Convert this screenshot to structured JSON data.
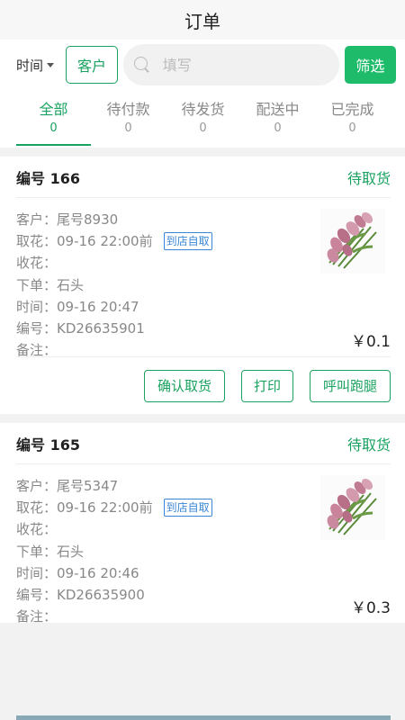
{
  "header": {
    "title": "订单"
  },
  "filter": {
    "time_label": "时间",
    "customer_label": "客户",
    "search_placeholder": "填写",
    "screen_label": "筛选"
  },
  "tabs": [
    {
      "label": "全部",
      "count": "0",
      "active": true
    },
    {
      "label": "待付款",
      "count": "0"
    },
    {
      "label": "待发货",
      "count": "0"
    },
    {
      "label": "配送中",
      "count": "0"
    },
    {
      "label": "已完成",
      "count": "0"
    }
  ],
  "orders": [
    {
      "number": "编号 166",
      "status": "待取货",
      "customer_key": "客户：",
      "customer": "尾号8930",
      "pickup_key": "取花：",
      "pickup": "09-16 22:00前",
      "pickup_tag": "到店自取",
      "receiver_key": "收花：",
      "receiver": "",
      "placer_key": "下单：",
      "placer": "石头",
      "time_key": "时间：",
      "time": "09-16 20:47",
      "code_key": "编号：",
      "code": "KD26635901",
      "note_key": "备注：",
      "note": "",
      "price": "￥0.1",
      "actions": [
        "确认取货",
        "打印",
        "呼叫跑腿"
      ]
    },
    {
      "number": "编号 165",
      "status": "待取货",
      "customer_key": "客户：",
      "customer": "尾号5347",
      "pickup_key": "取花：",
      "pickup": "09-16 22:00前",
      "pickup_tag": "到店自取",
      "receiver_key": "收花：",
      "receiver": "",
      "placer_key": "下单：",
      "placer": "石头",
      "time_key": "时间：",
      "time": "09-16 20:46",
      "code_key": "编号：",
      "code": "KD26635900",
      "note_key": "备注：",
      "note": "",
      "price": "￥0.3"
    }
  ],
  "colors": {
    "accent": "#1aa260",
    "tag_blue": "#3a86d6"
  }
}
